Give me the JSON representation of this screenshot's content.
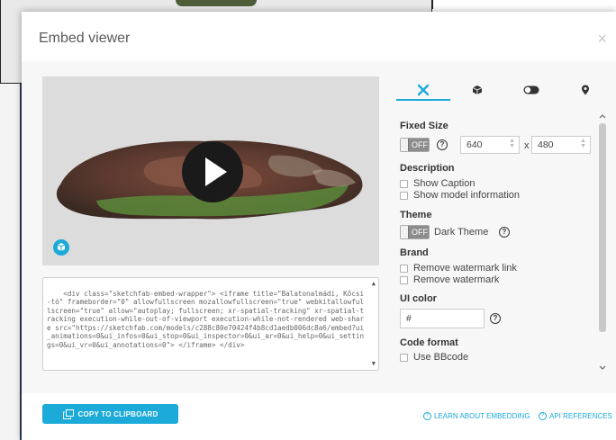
{
  "modal": {
    "title": "Embed viewer",
    "close_glyph": "×"
  },
  "viewer": {
    "model_name": "Balatonalmádi, Kőcsi-tó"
  },
  "code_snippet": "<div class=\"sketchfab-embed-wrapper\"> <iframe title=\"Balatonalmádi, Kőcsi-tó\" frameborder=\"0\" allowfullscreen mozallowfullscreen=\"true\" webkitallowfullscreen=\"true\" allow=\"autoplay; fullscreen; xr-spatial-tracking\" xr-spatial-tracking execution-while-out-of-viewport execution-while-not-rendered web-share src=\"https://sketchfab.com/models/c288c80e70424f4b8cd1aedb006dc8a6/embed?ui_animations=0&ui_infos=0&ui_stop=0&ui_inspector=0&ui_ar=0&ui_help=0&ui_settings=0&ui_vr=0&ui_annotations=0\"> </iframe> </div>",
  "tabs": [
    {
      "icon": "wrench-icon",
      "active": true
    },
    {
      "icon": "cube-icon",
      "active": false
    },
    {
      "icon": "toggle-icon",
      "active": false
    },
    {
      "icon": "map-pin-icon",
      "active": false
    }
  ],
  "settings": {
    "fixed_size": {
      "label": "Fixed Size",
      "toggle": "OFF",
      "width": "640",
      "x_label": "x",
      "height": "480"
    },
    "description": {
      "label": "Description",
      "show_caption": "Show Caption",
      "show_model_info": "Show model information"
    },
    "theme": {
      "label": "Theme",
      "toggle": "OFF",
      "dark_theme": "Dark Theme"
    },
    "brand": {
      "label": "Brand",
      "remove_link": "Remove watermark link",
      "remove_watermark": "Remove watermark"
    },
    "ui_color": {
      "label": "UI color",
      "value": "#"
    },
    "code_format": {
      "label": "Code format",
      "use_bbcode": "Use BBcode"
    }
  },
  "footer": {
    "copy_button": "COPY TO CLIPBOARD",
    "learn_link": "LEARN ABOUT EMBEDDING",
    "api_link": "API REFERENCES"
  },
  "colors": {
    "accent": "#1caad9",
    "toggle_off": "#8c8c8c"
  }
}
